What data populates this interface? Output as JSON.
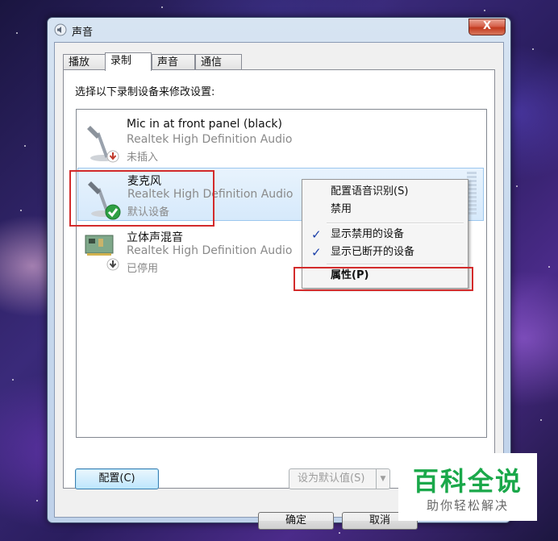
{
  "window": {
    "title": "声音",
    "close_label": "X"
  },
  "tabs": [
    {
      "label": "播放"
    },
    {
      "label": "录制"
    },
    {
      "label": "声音"
    },
    {
      "label": "通信"
    }
  ],
  "instruction": "选择以下录制设备来修改设置:",
  "devices": [
    {
      "name": "Mic in at front panel (black)",
      "driver": "Realtek High Definition Audio",
      "status": "未插入",
      "icon": "microphone-icon"
    },
    {
      "name": "麦克风",
      "driver": "Realtek High Definition Audio",
      "status": "默认设备",
      "icon": "microphone-icon"
    },
    {
      "name": "立体声混音",
      "driver": "Realtek High Definition Audio",
      "status": "已停用",
      "icon": "sound-card-icon"
    }
  ],
  "context_menu": {
    "items": [
      {
        "label": "配置语音识别(S)",
        "checked": false
      },
      {
        "label": "禁用",
        "checked": false
      },
      {
        "label": "显示禁用的设备",
        "checked": true
      },
      {
        "label": "显示已断开的设备",
        "checked": true
      },
      {
        "label": "属性(P)",
        "checked": false
      }
    ]
  },
  "buttons": {
    "configure": "配置(C)",
    "set_default": "设为默认值(S)",
    "ok": "确定",
    "cancel": "取消"
  },
  "watermark": {
    "title": "百科全说",
    "subtitle": "助你轻松解决"
  },
  "colors": {
    "watermark_green": "#1aa84a",
    "highlight_red": "#d32b2b",
    "selection_blue": "#d6e9fb"
  }
}
